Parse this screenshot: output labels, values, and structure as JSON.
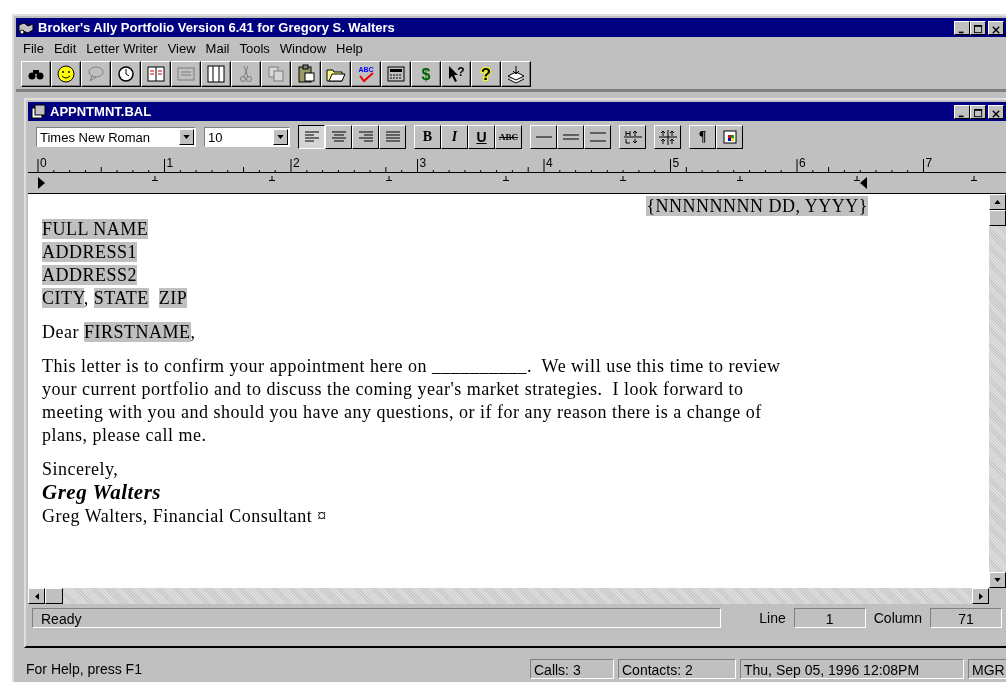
{
  "window": {
    "title": "Broker's Ally Portfolio Version 6.41 for Gregory S. Walters"
  },
  "menu": [
    {
      "label": "File"
    },
    {
      "label": "Edit"
    },
    {
      "label": "Letter Writer"
    },
    {
      "label": "View"
    },
    {
      "label": "Mail"
    },
    {
      "label": "Tools"
    },
    {
      "label": "Window"
    },
    {
      "label": "Help"
    }
  ],
  "toolbar": [
    {
      "kind": "binoculars",
      "disabled": false
    },
    {
      "kind": "smiley",
      "disabled": false
    },
    {
      "kind": "bubble",
      "disabled": true
    },
    {
      "kind": "clock",
      "disabled": false
    },
    {
      "kind": "planner",
      "disabled": false
    },
    {
      "kind": "card",
      "disabled": true
    },
    {
      "kind": "book",
      "disabled": false
    },
    {
      "kind": "scissors",
      "disabled": true
    },
    {
      "kind": "copy",
      "disabled": true
    },
    {
      "kind": "paste",
      "disabled": false
    },
    {
      "kind": "folder",
      "disabled": false
    },
    {
      "kind": "spell",
      "disabled": false,
      "glyph": "ABC"
    },
    {
      "kind": "calculator",
      "disabled": false
    },
    {
      "kind": "dollar",
      "disabled": false,
      "glyph": "$"
    },
    {
      "kind": "pointer",
      "disabled": false,
      "glyph": "?"
    },
    {
      "kind": "help",
      "disabled": false,
      "glyph": "?"
    },
    {
      "kind": "stack",
      "disabled": false
    }
  ],
  "document": {
    "title": "APPNTMNT.BAL",
    "font": "Times New Roman",
    "size": "10",
    "format_groups": [
      [
        {
          "kind": "align-left",
          "selected": true
        },
        {
          "kind": "align-center",
          "selected": false
        },
        {
          "kind": "align-right",
          "selected": false
        },
        {
          "kind": "justify",
          "selected": false
        }
      ],
      [
        {
          "kind": "bold",
          "glyph": "B",
          "selected": false
        },
        {
          "kind": "italic",
          "glyph": "I",
          "selected": false
        },
        {
          "kind": "underline",
          "glyph": "U",
          "selected": false
        },
        {
          "kind": "strike",
          "glyph": "ABC",
          "selected": false
        }
      ],
      [
        {
          "kind": "single",
          "selected": false
        },
        {
          "kind": "one-half",
          "selected": false
        },
        {
          "kind": "double",
          "selected": false
        }
      ],
      [
        {
          "kind": "heading",
          "selected": false
        }
      ],
      [
        {
          "kind": "indent",
          "selected": false
        }
      ],
      [
        {
          "kind": "pilcrow",
          "glyph": "¶",
          "selected": false
        },
        {
          "kind": "color",
          "selected": false
        }
      ]
    ],
    "ruler": [
      "0",
      "1",
      "2",
      "3",
      "4",
      "5",
      "6",
      "7"
    ],
    "date_field": "{NNNNNNNN DD, YYYY}",
    "address": [
      [
        {
          "text": "FULL NAME",
          "field": true
        }
      ],
      [
        {
          "text": "ADDRESS1",
          "field": true
        }
      ],
      [
        {
          "text": "ADDRESS2",
          "field": true
        }
      ],
      [
        {
          "text": "CITY",
          "field": true
        },
        {
          "text": ",",
          "field": false
        },
        {
          "text": "STATE",
          "field": true
        },
        {
          "text": "ZIP",
          "field": true
        }
      ]
    ],
    "salutation": [
      {
        "text": "Dear",
        "field": false
      },
      {
        "text": "FIRSTNAME",
        "field": true
      },
      {
        "text": ",",
        "field": false
      }
    ],
    "body": [
      "This letter is to confirm your appointment here on __________.  We will use this time to review",
      "your current portfolio and to discuss the coming year's market strategies.  I look forward to",
      "meeting with you and should you have any questions, or if for any reason there is a change of",
      "plans, please call me."
    ],
    "closing": "Sincerely,",
    "signature": "Greg Walters",
    "signer": "Greg Walters, Financial Consultant ¤",
    "status": {
      "message": "Ready",
      "line_label": "Line",
      "line": "1",
      "column_label": "Column",
      "column": "71"
    }
  },
  "status_bar": {
    "help": "For Help, press F1",
    "calls": "Calls: 3",
    "contacts": "Contacts: 2",
    "datetime": "Thu, Sep 05, 1996  12:08PM",
    "user": "MGR"
  }
}
